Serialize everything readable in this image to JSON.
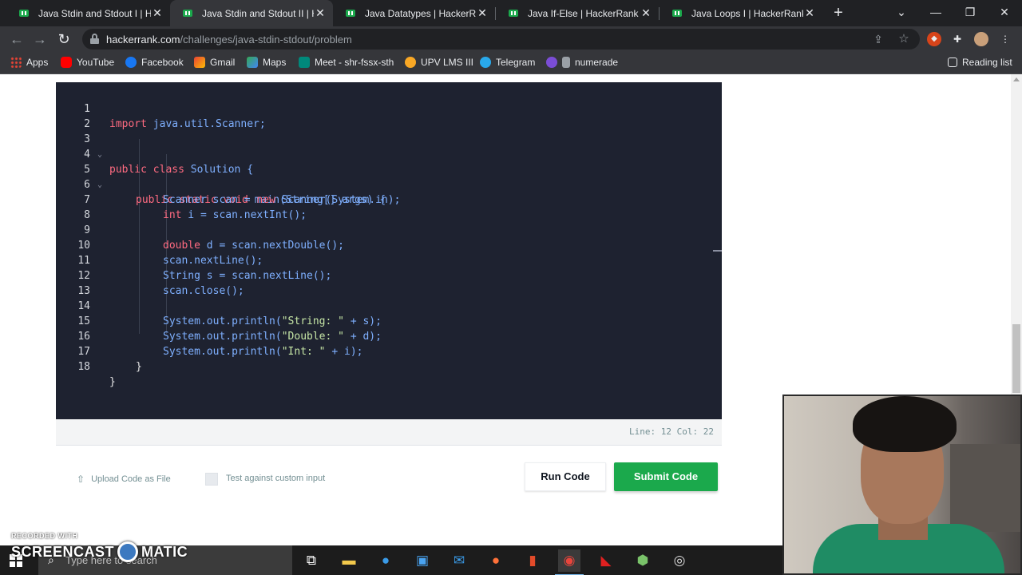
{
  "browser": {
    "tabs": [
      {
        "title": "Java Stdin and Stdout I | HackerRank",
        "active": false
      },
      {
        "title": "Java Stdin and Stdout II | HackerRank",
        "active": true
      },
      {
        "title": "Java Datatypes | HackerRank",
        "active": false
      },
      {
        "title": "Java If-Else | HackerRank",
        "active": false
      },
      {
        "title": "Java Loops I | HackerRank",
        "active": false
      }
    ],
    "url_host": "hackerrank.com",
    "url_path": "/challenges/java-stdin-stdout/problem",
    "bookmarks": [
      "Apps",
      "YouTube",
      "Facebook",
      "Gmail",
      "Maps",
      "Meet - shr-fssx-sth",
      "UPV LMS III",
      "Telegram",
      "numerade"
    ],
    "reading_list": "Reading list"
  },
  "editor": {
    "status": "Line: 12 Col: 22",
    "lines": [
      {
        "n": "1"
      },
      {
        "n": "2"
      },
      {
        "n": "3"
      },
      {
        "n": "4"
      },
      {
        "n": "5"
      },
      {
        "n": "6"
      },
      {
        "n": "7"
      },
      {
        "n": "8"
      },
      {
        "n": "9"
      },
      {
        "n": "10"
      },
      {
        "n": "11"
      },
      {
        "n": "12"
      },
      {
        "n": "13"
      },
      {
        "n": "14"
      },
      {
        "n": "15"
      },
      {
        "n": "16"
      },
      {
        "n": "17"
      },
      {
        "n": "18"
      }
    ],
    "code": {
      "l1_kw": "import",
      "l1_rest": " java.util.Scanner;",
      "l3_kw": "public class",
      "l3_rest": " Solution {",
      "l5_kw": "public static void",
      "l5_rest": " main(String[] args) {",
      "l6_a": "Scanner scan = ",
      "l6_kw": "new",
      "l6_b": " Scanner(System.in);",
      "l7_kw": "int",
      "l7_rest": " i = scan.nextInt();",
      "l9_kw": "double",
      "l9_rest": " d = scan.nextDouble();",
      "l10": "scan.nextLine();",
      "l11": "String s = scan.nextLine();",
      "l12": "scan.close();",
      "l14_a": "System.out.println(",
      "l14_s": "\"String: \"",
      "l14_b": " + s);",
      "l15_a": "System.out.println(",
      "l15_s": "\"Double: \"",
      "l15_b": " + d);",
      "l16_a": "System.out.println(",
      "l16_s": "\"Int: \"",
      "l16_b": " + i);",
      "l17": "}",
      "l18": "}"
    }
  },
  "actions": {
    "upload": "Upload Code as File",
    "custom_input": "Test against custom input",
    "run": "Run Code",
    "submit": "Submit Code"
  },
  "taskbar": {
    "search_placeholder": "Type here to search"
  },
  "watermark": {
    "line1": "RECORDED WITH",
    "line2a": "SCREENCAST",
    "line2b": "MATIC"
  },
  "colors": {
    "accent_green": "#1ba94c",
    "editor_bg": "#1e2230",
    "keyword": "#ff6b81"
  }
}
